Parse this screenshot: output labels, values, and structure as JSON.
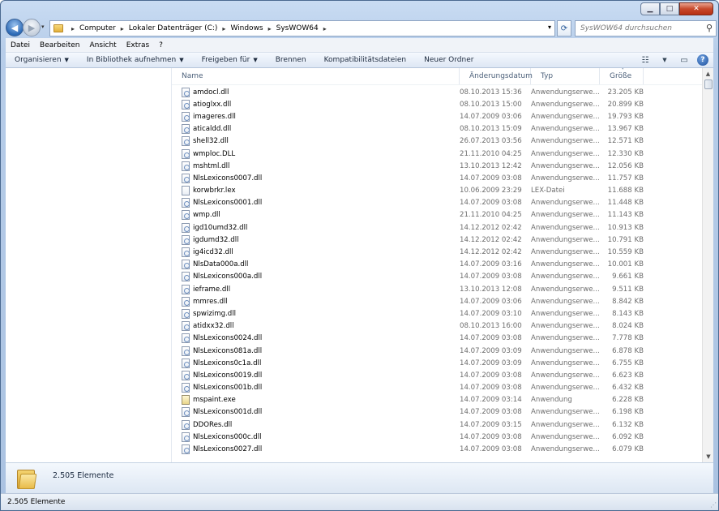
{
  "window": {
    "controls": {
      "minimize": "▁",
      "maximize": "□",
      "close": "✕"
    }
  },
  "nav": {
    "back_icon": "◀",
    "forward_icon": "▶",
    "dropdown_icon": "▾"
  },
  "address": {
    "crumbs": [
      "Computer",
      "Lokaler Datenträger (C:)",
      "Windows",
      "SysWOW64"
    ]
  },
  "search": {
    "placeholder": "SysWOW64 durchsuchen"
  },
  "menu": [
    "Datei",
    "Bearbeiten",
    "Ansicht",
    "Extras",
    "?"
  ],
  "toolbar": {
    "organize": "Organisieren",
    "library": "In Bibliothek aufnehmen",
    "share": "Freigeben für",
    "burn": "Brennen",
    "compat": "Kompatibilitätsdateien",
    "new_folder": "Neuer Ordner"
  },
  "columns": {
    "name": "Name",
    "date": "Änderungsdatum",
    "type": "Typ",
    "size": "Größe"
  },
  "files": [
    {
      "name": "amdocl.dll",
      "date": "08.10.2013 15:36",
      "type": "Anwendungserwe...",
      "size": "23.205 KB",
      "icon": "dll"
    },
    {
      "name": "atioglxx.dll",
      "date": "08.10.2013 15:00",
      "type": "Anwendungserwe...",
      "size": "20.899 KB",
      "icon": "dll"
    },
    {
      "name": "imageres.dll",
      "date": "14.07.2009 03:06",
      "type": "Anwendungserwe...",
      "size": "19.793 KB",
      "icon": "dll"
    },
    {
      "name": "aticaldd.dll",
      "date": "08.10.2013 15:09",
      "type": "Anwendungserwe...",
      "size": "13.967 KB",
      "icon": "dll"
    },
    {
      "name": "shell32.dll",
      "date": "26.07.2013 03:56",
      "type": "Anwendungserwe...",
      "size": "12.571 KB",
      "icon": "dll"
    },
    {
      "name": "wmploc.DLL",
      "date": "21.11.2010 04:25",
      "type": "Anwendungserwe...",
      "size": "12.330 KB",
      "icon": "dll"
    },
    {
      "name": "mshtml.dll",
      "date": "13.10.2013 12:42",
      "type": "Anwendungserwe...",
      "size": "12.056 KB",
      "icon": "dll"
    },
    {
      "name": "NlsLexicons0007.dll",
      "date": "14.07.2009 03:08",
      "type": "Anwendungserwe...",
      "size": "11.757 KB",
      "icon": "dll"
    },
    {
      "name": "korwbrkr.lex",
      "date": "10.06.2009 23:29",
      "type": "LEX-Datei",
      "size": "11.688 KB",
      "icon": "file"
    },
    {
      "name": "NlsLexicons0001.dll",
      "date": "14.07.2009 03:08",
      "type": "Anwendungserwe...",
      "size": "11.448 KB",
      "icon": "dll"
    },
    {
      "name": "wmp.dll",
      "date": "21.11.2010 04:25",
      "type": "Anwendungserwe...",
      "size": "11.143 KB",
      "icon": "dll"
    },
    {
      "name": "igd10umd32.dll",
      "date": "14.12.2012 02:42",
      "type": "Anwendungserwe...",
      "size": "10.913 KB",
      "icon": "dll"
    },
    {
      "name": "igdumd32.dll",
      "date": "14.12.2012 02:42",
      "type": "Anwendungserwe...",
      "size": "10.791 KB",
      "icon": "dll"
    },
    {
      "name": "ig4icd32.dll",
      "date": "14.12.2012 02:42",
      "type": "Anwendungserwe...",
      "size": "10.559 KB",
      "icon": "dll"
    },
    {
      "name": "NlsData000a.dll",
      "date": "14.07.2009 03:16",
      "type": "Anwendungserwe...",
      "size": "10.001 KB",
      "icon": "dll"
    },
    {
      "name": "NlsLexicons000a.dll",
      "date": "14.07.2009 03:08",
      "type": "Anwendungserwe...",
      "size": "9.661 KB",
      "icon": "dll"
    },
    {
      "name": "ieframe.dll",
      "date": "13.10.2013 12:08",
      "type": "Anwendungserwe...",
      "size": "9.511 KB",
      "icon": "dll"
    },
    {
      "name": "mmres.dll",
      "date": "14.07.2009 03:06",
      "type": "Anwendungserwe...",
      "size": "8.842 KB",
      "icon": "dll"
    },
    {
      "name": "spwizimg.dll",
      "date": "14.07.2009 03:10",
      "type": "Anwendungserwe...",
      "size": "8.143 KB",
      "icon": "dll"
    },
    {
      "name": "atidxx32.dll",
      "date": "08.10.2013 16:00",
      "type": "Anwendungserwe...",
      "size": "8.024 KB",
      "icon": "dll"
    },
    {
      "name": "NlsLexicons0024.dll",
      "date": "14.07.2009 03:08",
      "type": "Anwendungserwe...",
      "size": "7.778 KB",
      "icon": "dll"
    },
    {
      "name": "NlsLexicons081a.dll",
      "date": "14.07.2009 03:09",
      "type": "Anwendungserwe...",
      "size": "6.878 KB",
      "icon": "dll"
    },
    {
      "name": "NlsLexicons0c1a.dll",
      "date": "14.07.2009 03:09",
      "type": "Anwendungserwe...",
      "size": "6.755 KB",
      "icon": "dll"
    },
    {
      "name": "NlsLexicons0019.dll",
      "date": "14.07.2009 03:08",
      "type": "Anwendungserwe...",
      "size": "6.623 KB",
      "icon": "dll"
    },
    {
      "name": "NlsLexicons001b.dll",
      "date": "14.07.2009 03:08",
      "type": "Anwendungserwe...",
      "size": "6.432 KB",
      "icon": "dll"
    },
    {
      "name": "mspaint.exe",
      "date": "14.07.2009 03:14",
      "type": "Anwendung",
      "size": "6.228 KB",
      "icon": "exe"
    },
    {
      "name": "NlsLexicons001d.dll",
      "date": "14.07.2009 03:08",
      "type": "Anwendungserwe...",
      "size": "6.198 KB",
      "icon": "dll"
    },
    {
      "name": "DDORes.dll",
      "date": "14.07.2009 03:15",
      "type": "Anwendungserwe...",
      "size": "6.132 KB",
      "icon": "dll"
    },
    {
      "name": "NlsLexicons000c.dll",
      "date": "14.07.2009 03:08",
      "type": "Anwendungserwe...",
      "size": "6.092 KB",
      "icon": "dll"
    },
    {
      "name": "NlsLexicons0027.dll",
      "date": "14.07.2009 03:08",
      "type": "Anwendungserwe...",
      "size": "6.079 KB",
      "icon": "dll"
    }
  ],
  "details": {
    "count": "2.505 Elemente"
  },
  "status": {
    "text": "2.505 Elemente"
  }
}
